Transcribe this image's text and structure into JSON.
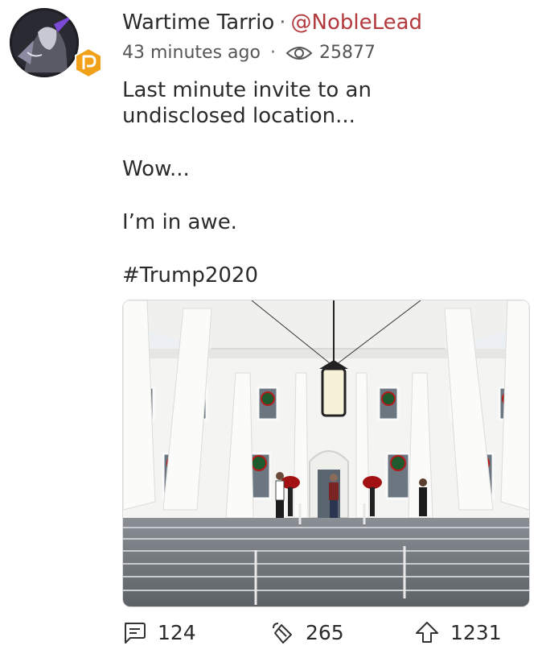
{
  "post": {
    "author_name": "Wartime Tarrio",
    "separator": "·",
    "handle": "@NobleLead",
    "timestamp": "43 minutes ago",
    "meta_separator": "·",
    "view_count": "25877",
    "text_line1": "Last minute invite to an",
    "text_line2": "undisclosed location...",
    "text_line3": "Wow...",
    "text_line4": "I’m in awe.",
    "text_line5": "#Trump2020"
  },
  "actions": {
    "comments": "124",
    "echoes": "265",
    "upvotes": "1231"
  },
  "colors": {
    "handle": "#b3393c",
    "badge": "#f0a019",
    "text": "#2b2b2b"
  },
  "icons": [
    "avatar",
    "parler-badge-icon",
    "eye-icon",
    "comment-icon",
    "echo-icon",
    "upvote-icon"
  ]
}
